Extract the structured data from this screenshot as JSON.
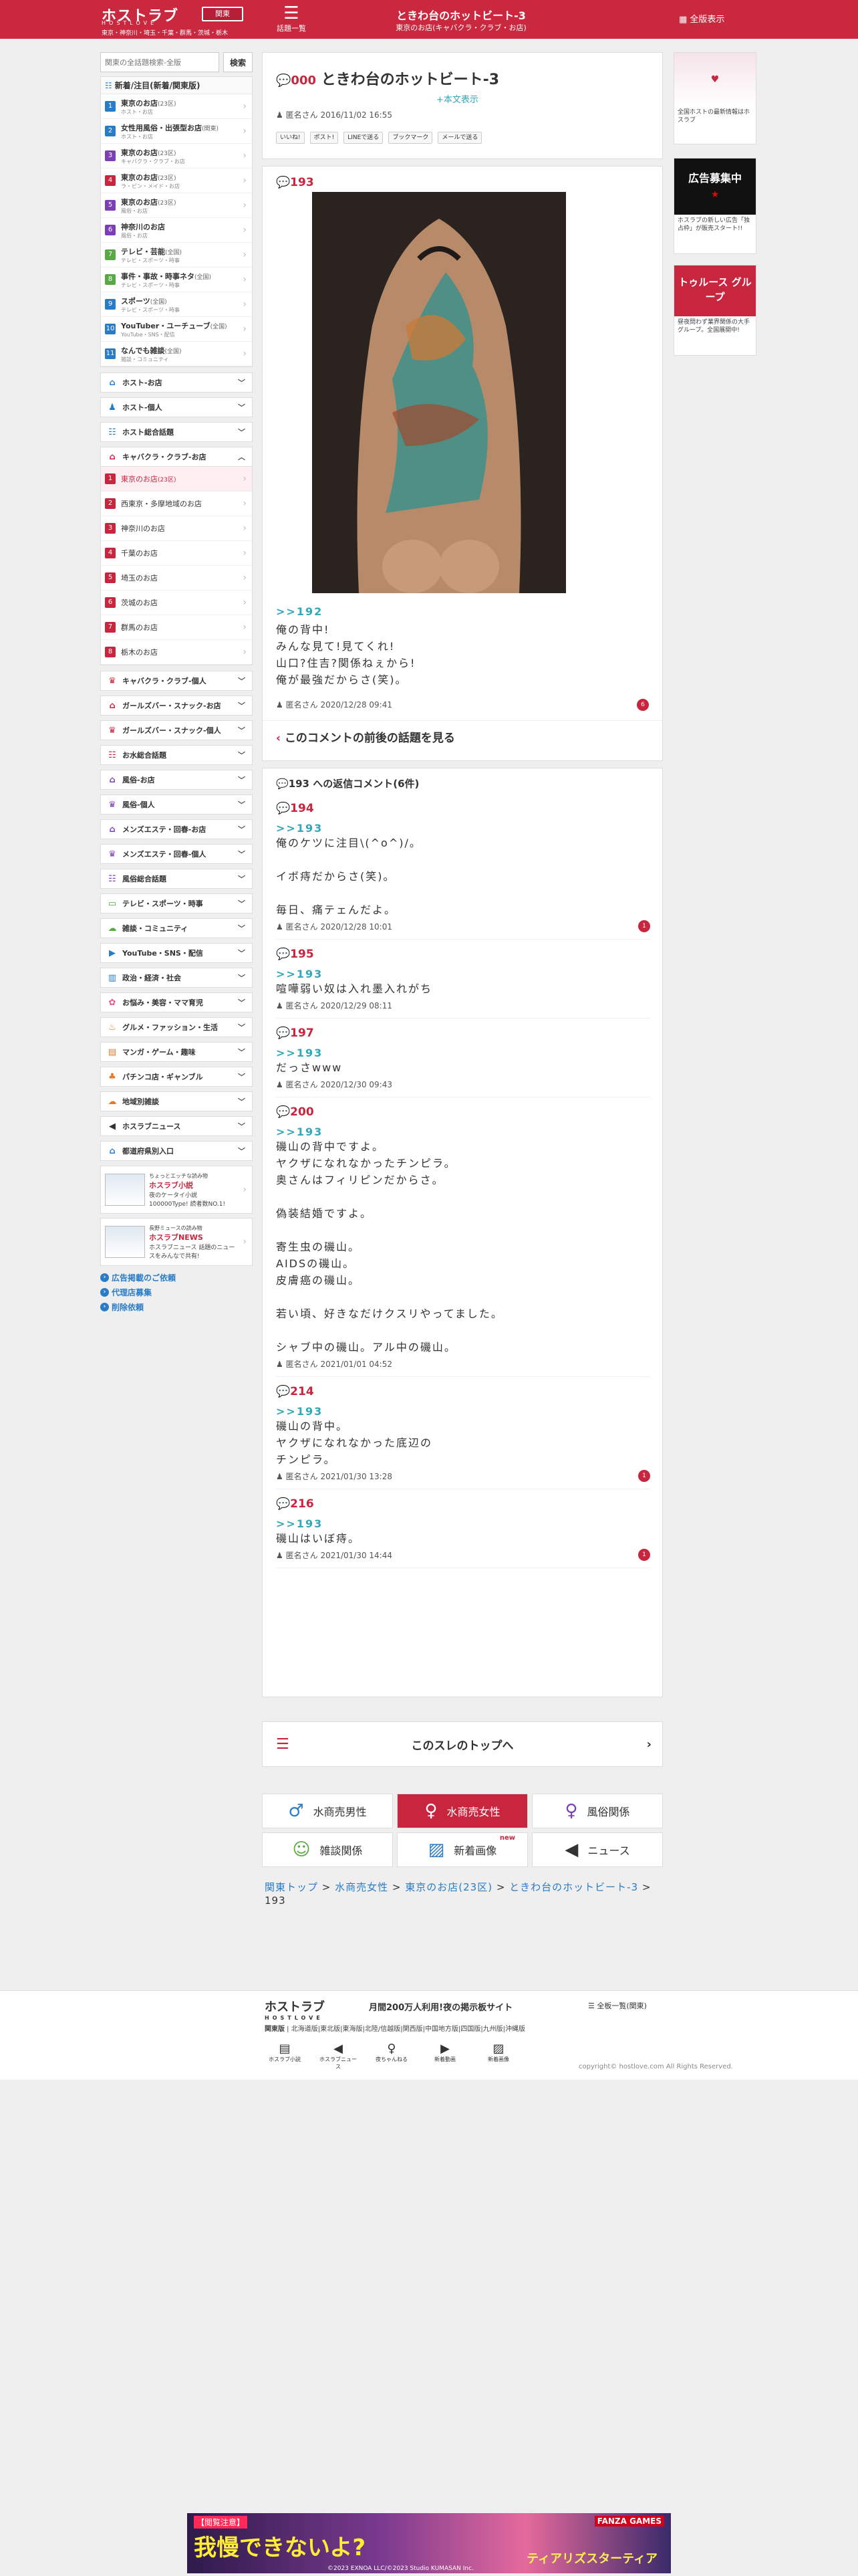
{
  "header": {
    "logo": "ホストラブ",
    "logo_sub": "HOSTLOVE",
    "region_button": "関東",
    "region_list": "東京・神奈川・埼玉・千葉・群馬・茨城・栃木",
    "board_list": "話題一覧",
    "thread_title": "ときわ台のホットビート-3",
    "thread_sub": "東京のお店(キャバクラ・クラブ・お店)",
    "full_view": "全版表示"
  },
  "sidebar": {
    "search_placeholder": "関東の全話題検索-全版",
    "search_button": "検索",
    "new_title": "新着/注目(新着/関東版)",
    "new_items": [
      {
        "n": "1",
        "t": "東京のお店",
        "c": "(23区)",
        "s": "ホスト・お店",
        "color": "#2a7cc7"
      },
      {
        "n": "2",
        "t": "女性用風俗・出張型お店",
        "c": "(関東)",
        "s": "ホスト・お店",
        "color": "#2a7cc7"
      },
      {
        "n": "3",
        "t": "東京のお店",
        "c": "(23区)",
        "s": "キャバクラ・クラブ・お店",
        "color": "#7d3fb8"
      },
      {
        "n": "4",
        "t": "東京のお店",
        "c": "(23区)",
        "s": "ラ・ピン・メイド・お店",
        "color": "#c8253f"
      },
      {
        "n": "5",
        "t": "東京のお店",
        "c": "(23区)",
        "s": "風俗・お店",
        "color": "#7d3fb8"
      },
      {
        "n": "6",
        "t": "神奈川のお店",
        "c": "",
        "s": "風俗・お店",
        "color": "#7d3fb8"
      },
      {
        "n": "7",
        "t": "テレビ・芸能",
        "c": "(全国)",
        "s": "テレビ・スポーツ・時事",
        "color": "#58a843"
      },
      {
        "n": "8",
        "t": "事件・事故・時事ネタ",
        "c": "(全国)",
        "s": "テレビ・スポーツ・時事",
        "color": "#58a843"
      },
      {
        "n": "9",
        "t": "スポーツ",
        "c": "(全国)",
        "s": "テレビ・スポーツ・時事",
        "color": "#2a7cc7"
      },
      {
        "n": "10",
        "t": "YouTuber・ユーチューブ",
        "c": "(全国)",
        "s": "YouTube・SNS・配信",
        "color": "#2a7cc7"
      },
      {
        "n": "11",
        "t": "なんでも雑談",
        "c": "(全国)",
        "s": "雑談・コミュニティ",
        "color": "#2a7cc7"
      }
    ],
    "cats_top": [
      {
        "icon": "⌂",
        "label": "ホスト-お店",
        "color": "#2a7cc7"
      },
      {
        "icon": "♟",
        "label": "ホスト-個人",
        "color": "#2a7cc7"
      },
      {
        "icon": "☷",
        "label": "ホスト総合話題",
        "color": "#2a7cc7"
      }
    ],
    "kyaba": {
      "icon": "⌂",
      "label": "キャバクラ・クラブ-お店",
      "color": "#c8253f",
      "items": [
        {
          "n": "1",
          "t": "東京のお店",
          "c": "(23区)"
        },
        {
          "n": "2",
          "t": "西東京・多摩地域のお店",
          "c": ""
        },
        {
          "n": "3",
          "t": "神奈川のお店",
          "c": ""
        },
        {
          "n": "4",
          "t": "千葉のお店",
          "c": ""
        },
        {
          "n": "5",
          "t": "埼玉のお店",
          "c": ""
        },
        {
          "n": "6",
          "t": "茨城のお店",
          "c": ""
        },
        {
          "n": "7",
          "t": "群馬のお店",
          "c": ""
        },
        {
          "n": "8",
          "t": "栃木のお店",
          "c": ""
        }
      ]
    },
    "cats_bottom": [
      {
        "icon": "♛",
        "label": "キャバクラ・クラブ-個人",
        "color": "#c8253f"
      },
      {
        "icon": "⌂",
        "label": "ガールズバー・スナック-お店",
        "color": "#c8253f"
      },
      {
        "icon": "♛",
        "label": "ガールズバー・スナック-個人",
        "color": "#c8253f"
      },
      {
        "icon": "☷",
        "label": "お水総合話題",
        "color": "#c8253f"
      },
      {
        "icon": "⌂",
        "label": "風俗-お店",
        "color": "#7d3fb8"
      },
      {
        "icon": "♛",
        "label": "風俗-個人",
        "color": "#7d3fb8"
      },
      {
        "icon": "⌂",
        "label": "メンズエステ・回春-お店",
        "color": "#7d3fb8"
      },
      {
        "icon": "♛",
        "label": "メンズエステ・回春-個人",
        "color": "#7d3fb8"
      },
      {
        "icon": "☷",
        "label": "風俗総合話題",
        "color": "#7d3fb8"
      },
      {
        "icon": "▭",
        "label": "テレビ・スポーツ・時事",
        "color": "#58a843"
      },
      {
        "icon": "☁",
        "label": "雑談・コミュニティ",
        "color": "#58a843"
      },
      {
        "icon": "▶",
        "label": "YouTube・SNS・配信",
        "color": "#2a7cc7"
      },
      {
        "icon": "▥",
        "label": "政治・経済・社会",
        "color": "#2a7cc7"
      },
      {
        "icon": "✿",
        "label": "お悩み・美容・ママ育児",
        "color": "#e0568c"
      },
      {
        "icon": "♨",
        "label": "グルメ・ファッション・生活",
        "color": "#e07a2a"
      },
      {
        "icon": "▤",
        "label": "マンガ・ゲーム・趣味",
        "color": "#e07a2a"
      },
      {
        "icon": "♣",
        "label": "パチンコ店・ギャンブル",
        "color": "#e07a2a"
      },
      {
        "icon": "☁",
        "label": "地域別雑談",
        "color": "#e07a2a"
      },
      {
        "icon": "◀",
        "label": "ホスラブニュース",
        "color": "#333333"
      },
      {
        "icon": "⌂",
        "label": "都道府県別入口",
        "color": "#2a7cc7"
      }
    ],
    "promos": [
      {
        "top": "ちょっとエッチな読み物",
        "logo": "ホスラブ小説",
        "text": "夜のケータイ小説 100000Type! 読者数NO.1!"
      },
      {
        "top": "長野ミュースの読み物",
        "logo": "ホスラブNEWS",
        "text": "ホスラブニュース 話題のニュースをみんなで共有!"
      }
    ],
    "links": [
      "広告掲載のご依頼",
      "代理店募集",
      "削除依頼"
    ]
  },
  "post": {
    "number": "000",
    "title": "ときわ台のホットビート-3",
    "full_text": "本文表示",
    "author": "匿名さん",
    "date": "2016/11/02 16:55",
    "share": [
      "いいね!",
      "ポスト!",
      "LINEで送る",
      "ブックマーク",
      "メールで送る"
    ]
  },
  "reply_main": {
    "number": "193",
    "anchor": ">>192",
    "body": "俺の背中!\nみんな見て!見てくれ!\n山口?住吉?関係ねぇから!\n俺が最強だからさ(笑)。",
    "author": "匿名さん",
    "date": "2020/12/28 09:41",
    "badge": "6",
    "context_link": "このコメントの前後の話題を見る"
  },
  "replies": {
    "header": "193 への返信コメント(6件)",
    "items": [
      {
        "number": "194",
        "anchor": ">>193",
        "body": "俺のケツに注目\\(^o^)/。\n\nイボ痔だからさ(笑)。\n\n毎日、痛テェんだよ。",
        "author": "匿名さん",
        "date": "2020/12/28 10:01",
        "badge": "1"
      },
      {
        "number": "195",
        "anchor": ">>193",
        "body": "喧嘩弱い奴は入れ墨入れがち",
        "author": "匿名さん",
        "date": "2020/12/29 08:11",
        "badge": ""
      },
      {
        "number": "197",
        "anchor": ">>193",
        "body": "だっさwww",
        "author": "匿名さん",
        "date": "2020/12/30 09:43",
        "badge": ""
      },
      {
        "number": "200",
        "anchor": ">>193",
        "body": "磯山の背中ですよ。\nヤクザになれなかったチンピラ。\n奥さんはフィリピンだからさ。\n\n偽装結婚ですよ。\n\n寄生虫の磯山。\nAIDSの磯山。\n皮膚癌の磯山。\n\n若い頃、好きなだけクスリやってました。\n\nシャブ中の磯山。アル中の磯山。",
        "author": "匿名さん",
        "date": "2021/01/01 04:52",
        "badge": ""
      },
      {
        "number": "214",
        "anchor": ">>193",
        "body": "磯山の背中。\nヤクザになれなかった底辺の\nチンピラ。",
        "author": "匿名さん",
        "date": "2021/01/30 13:28",
        "badge": "1"
      },
      {
        "number": "216",
        "anchor": ">>193",
        "body": "磯山はいぼ痔。",
        "author": "匿名さん",
        "date": "2021/01/30 14:44",
        "badge": "1"
      }
    ]
  },
  "thread_top": "このスレのトップへ",
  "categories": [
    {
      "icon": "♂",
      "label": "水商売男性",
      "color": "#2a7cc7",
      "active": false,
      "new": ""
    },
    {
      "icon": "♀",
      "label": "水商売女性",
      "color": "#ffffff",
      "active": true,
      "new": ""
    },
    {
      "icon": "♀",
      "label": "風俗関係",
      "color": "#7d3fb8",
      "active": false,
      "new": ""
    },
    {
      "icon": "☺",
      "label": "雑談関係",
      "color": "#58a843",
      "active": false,
      "new": ""
    },
    {
      "icon": "▨",
      "label": "新着画像",
      "color": "#2a7cc7",
      "active": false,
      "new": "new"
    },
    {
      "icon": "◀",
      "label": "ニュース",
      "color": "#333333",
      "active": false,
      "new": ""
    }
  ],
  "breadcrumb": [
    "関東トップ",
    "水商売女性",
    "東京のお店(23区)",
    "ときわ台のホットビート-3"
  ],
  "breadcrumb_current": "193",
  "ads": {
    "ad1_text": "全国ホストの最新情報はホスラブ",
    "ad2_title": "広告募集中",
    "ad2_text": "ホスラブの新しい広告「独占枠」が販売スタート!!",
    "ad3_title": "トゥルース グループ",
    "ad3_text": "昼夜問わず業界関係の大手グループ。全国展開中!"
  },
  "footer": {
    "logo": "ホストラブ",
    "logo_sub": "HOSTLOVE",
    "tagline": "月間200万人利用!夜の掲示板サイト",
    "all_button": "全板一覧(関東)",
    "region_label": "関東版",
    "regions": "北海道版|東北版|東海版|北陸/信越版|関西版|中国地方版|四国版|九州版|沖縄版",
    "icons": [
      "ホスラブ小説",
      "ホスラブニュース",
      "夜ちゃんねる",
      "新着動画",
      "新着画像"
    ],
    "copyright": "copyright© hostlove.com All Rights Reserved."
  },
  "banner": {
    "notice": "【閲覧注意】",
    "title": "我慢できないよ?",
    "label": "FANZA GAMES",
    "credit": "©2023 EXNOA LLC/©2023 Studio KUMASAN Inc.",
    "sub": "ティアリズスターティア"
  }
}
